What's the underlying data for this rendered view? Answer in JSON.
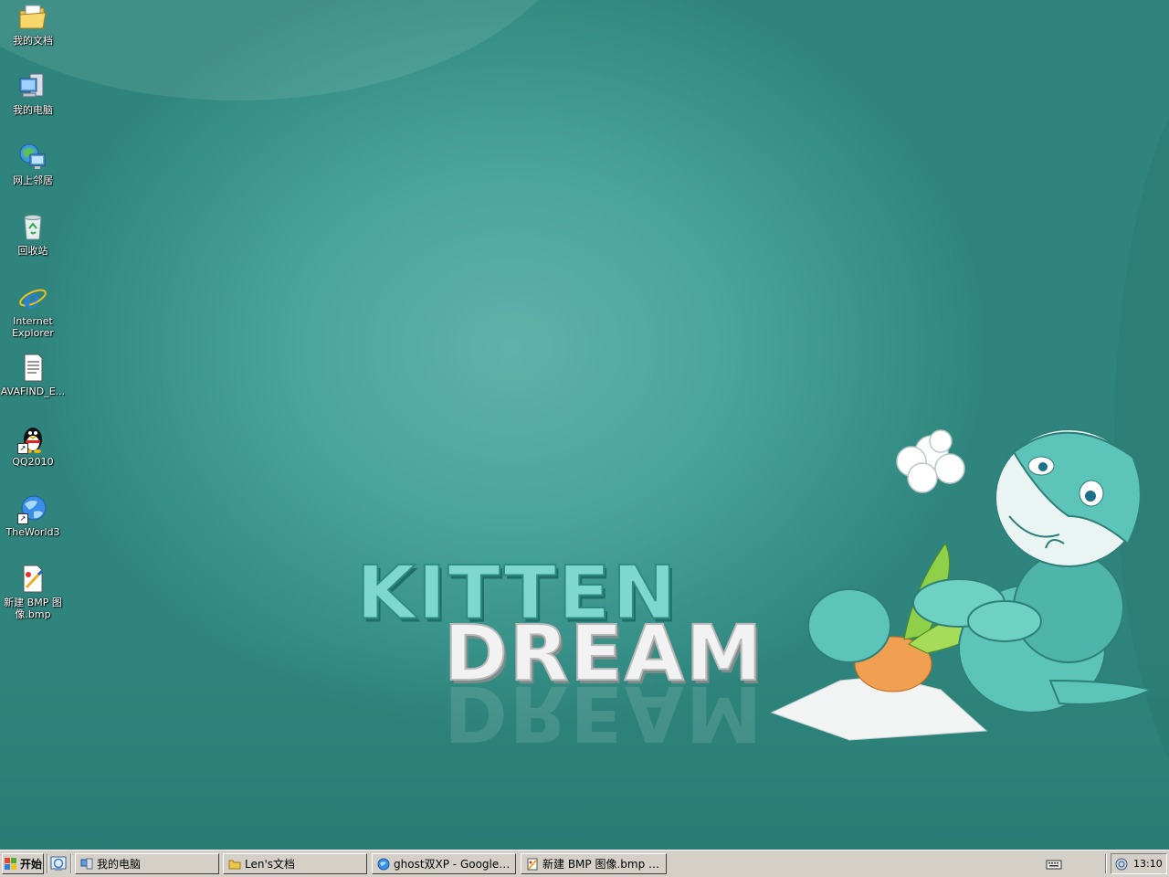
{
  "desktop": {
    "icons": [
      {
        "label": "我的文档",
        "icon": "my-documents-icon"
      },
      {
        "label": "我的电脑",
        "icon": "my-computer-icon"
      },
      {
        "label": "网上邻居",
        "icon": "network-places-icon"
      },
      {
        "label": "回收站",
        "icon": "recycle-bin-icon"
      },
      {
        "label": "Internet Explorer",
        "icon": "internet-explorer-icon"
      },
      {
        "label": "AVAFIND_E...",
        "icon": "text-file-icon"
      },
      {
        "label": "QQ2010",
        "icon": "qq-penguin-icon"
      },
      {
        "label": "TheWorld3",
        "icon": "theworld-browser-icon"
      },
      {
        "label": "新建 BMP 图像.bmp",
        "icon": "bmp-image-icon"
      }
    ],
    "wallpaper": {
      "line1": "KITTEN",
      "line2": "DREAM",
      "colors": {
        "background": "#4aa59c",
        "kitten_text": "#7ed8cf",
        "dream_text": "#f2f2f2"
      }
    }
  },
  "taskbar": {
    "start_label": "开始",
    "quick_launch": [
      {
        "icon": "show-desktop-icon"
      }
    ],
    "tasks": [
      {
        "label": "我的电脑",
        "icon": "my-computer-icon"
      },
      {
        "label": "Len's文档",
        "icon": "folder-icon"
      },
      {
        "label": "ghost双XP - Google 搜...",
        "icon": "browser-icon"
      },
      {
        "label": "新建 BMP 图像.bmp - 画图",
        "icon": "paint-icon"
      }
    ],
    "tray": {
      "keyboard_icon": "keyboard-icon",
      "clock": "13:10"
    }
  }
}
